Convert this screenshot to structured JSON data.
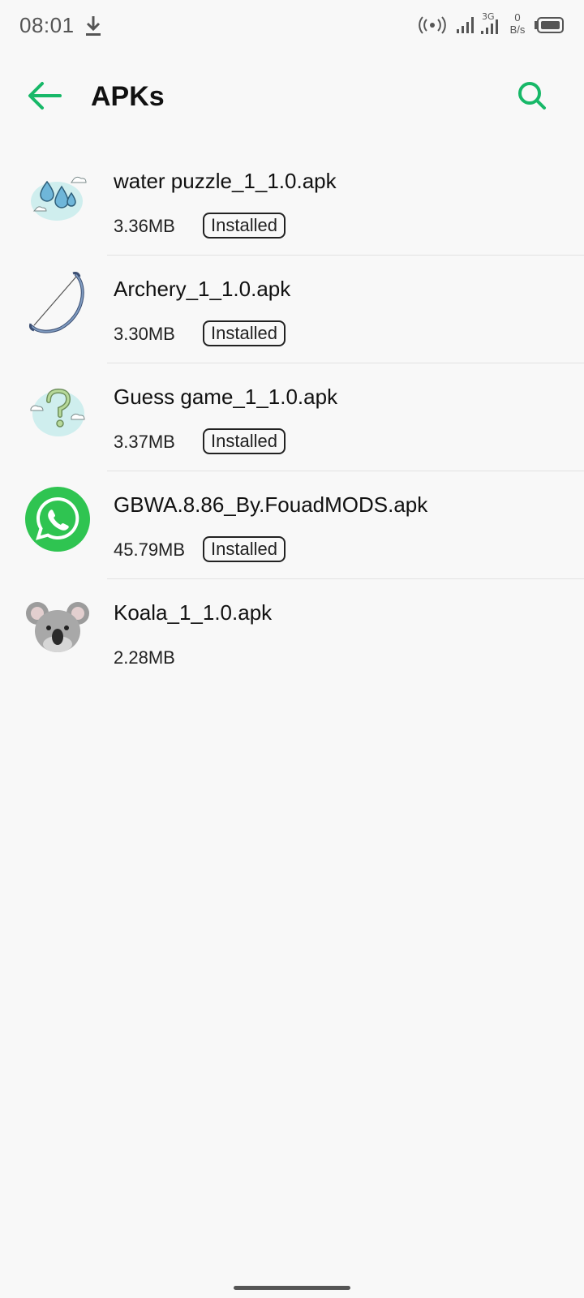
{
  "status_bar": {
    "time": "08:01",
    "net_speed_value": "0",
    "net_speed_unit": "B/s",
    "network_type": "3G"
  },
  "app_bar": {
    "title": "APKs",
    "accent_color": "#17b868"
  },
  "apks": [
    {
      "name": "water puzzle_1_1.0.apk",
      "size": "3.36MB",
      "status": "Installed",
      "icon": "water-drops-icon"
    },
    {
      "name": "Archery_1_1.0.apk",
      "size": "3.30MB",
      "status": "Installed",
      "icon": "bow-icon"
    },
    {
      "name": "Guess game_1_1.0.apk",
      "size": "3.37MB",
      "status": "Installed",
      "icon": "question-mark-cloud-icon"
    },
    {
      "name": "GBWA.8.86_By.FouadMODS.apk",
      "size": "45.79MB",
      "status": "Installed",
      "icon": "whatsapp-icon"
    },
    {
      "name": "Koala_1_1.0.apk",
      "size": "2.28MB",
      "status": "",
      "icon": "koala-icon"
    }
  ]
}
